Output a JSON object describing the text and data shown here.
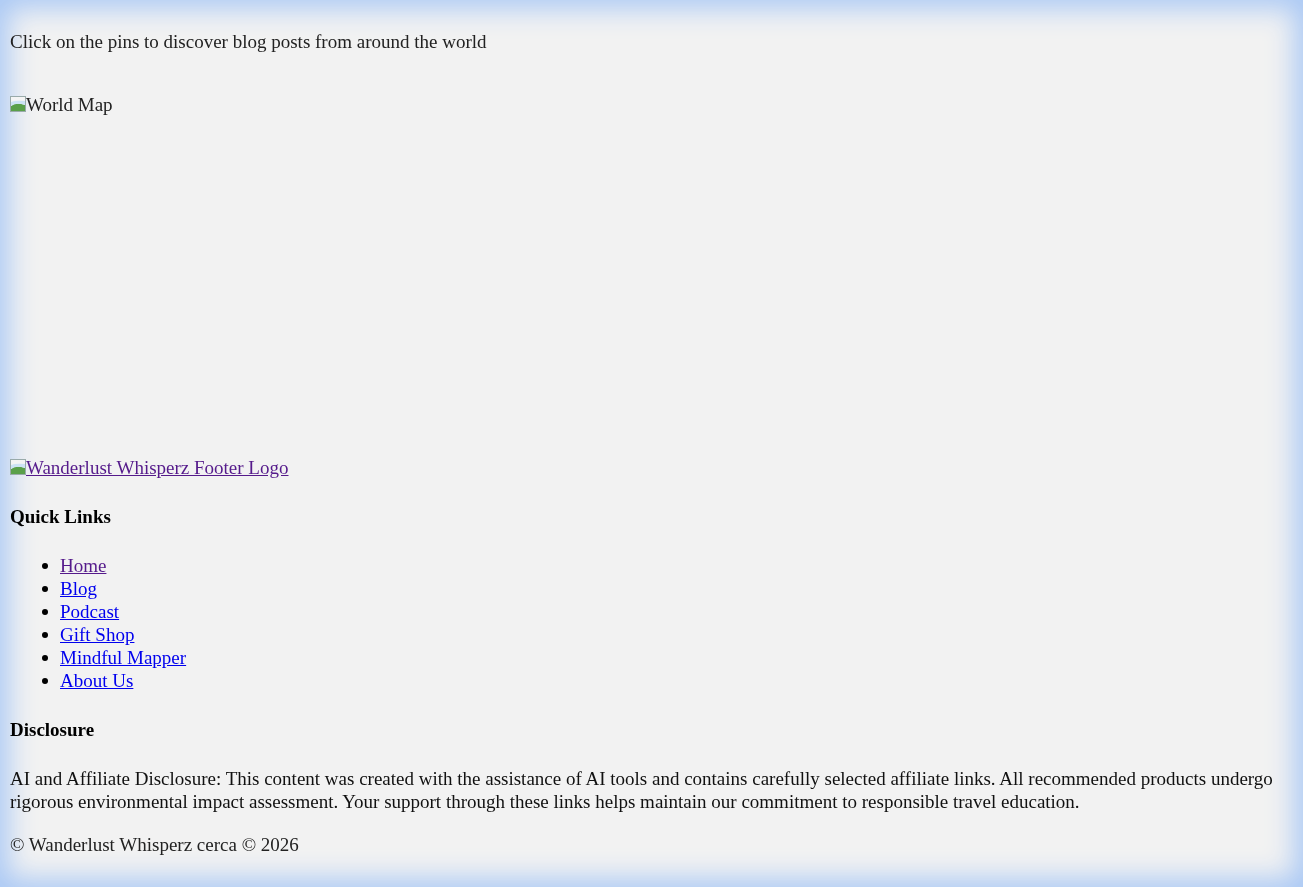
{
  "intro": "Click on the pins to discover blog posts from around the world",
  "map_image": {
    "alt": "World Map"
  },
  "footer_logo": {
    "alt": "Wanderlust Whisperz Footer Logo",
    "visited": true
  },
  "quick_links": {
    "heading": "Quick Links",
    "items": [
      {
        "label": "Home",
        "visited": true
      },
      {
        "label": "Blog",
        "visited": false
      },
      {
        "label": "Podcast",
        "visited": false
      },
      {
        "label": "Gift Shop",
        "visited": false
      },
      {
        "label": "Mindful Mapper",
        "visited": false
      },
      {
        "label": "About Us",
        "visited": false
      }
    ]
  },
  "disclosure": {
    "heading": "Disclosure",
    "text": "AI and Affiliate Disclosure: This content was created with the assistance of AI tools and contains carefully selected affiliate links. All recommended products undergo rigorous environmental impact assessment. Your support through these links helps maintain our commitment to responsible travel education."
  },
  "copyright": "© Wanderlust Whisperz cerca © 2026"
}
